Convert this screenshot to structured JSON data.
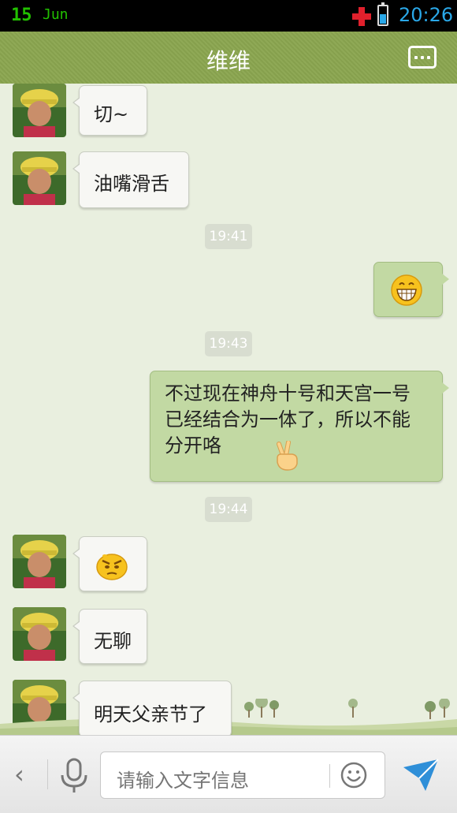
{
  "status": {
    "day": "15",
    "month": "Jun",
    "time": "20:26"
  },
  "header": {
    "title": "维维",
    "menu_icon": "more-dots-icon"
  },
  "messages": [
    {
      "type": "in",
      "text": "切~"
    },
    {
      "type": "in",
      "text": "油嘴滑舌"
    },
    {
      "type": "time",
      "text": "19:41"
    },
    {
      "type": "out",
      "emoji": "grin-emoji"
    },
    {
      "type": "time",
      "text": "19:43"
    },
    {
      "type": "out",
      "text": "不过现在神舟十号和天宫一号已经结合为一体了，所以不能分开咯",
      "emoji": "victory-hand-emoji"
    },
    {
      "type": "time",
      "text": "19:44"
    },
    {
      "type": "in",
      "emoji": "angry-face-emoji"
    },
    {
      "type": "in",
      "text": "无聊"
    },
    {
      "type": "in",
      "text": "明天父亲节了"
    }
  ],
  "input": {
    "placeholder": "请输入文字信息"
  },
  "colors": {
    "header": "#8aa552",
    "outgoing_bubble": "#c2d9a3",
    "incoming_bubble": "#f7f7f4",
    "time_accent": "#2aa8e8"
  }
}
